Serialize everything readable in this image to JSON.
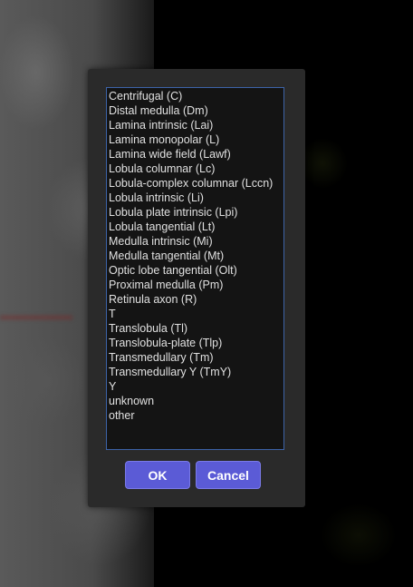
{
  "dialog": {
    "options": [
      "Centrifugal (C)",
      "Distal medulla (Dm)",
      "Lamina intrinsic (Lai)",
      "Lamina monopolar (L)",
      "Lamina wide field (Lawf)",
      "Lobula columnar (Lc)",
      "Lobula-complex columnar (Lccn)",
      "Lobula intrinsic (Li)",
      "Lobula plate intrinsic (Lpi)",
      "Lobula tangential (Lt)",
      "Medulla intrinsic (Mi)",
      "Medulla tangential (Mt)",
      "Optic lobe tangential (Olt)",
      "Proximal medulla (Pm)",
      "Retinula axon (R)",
      "T",
      "Translobula (Tl)",
      "Translobula-plate (Tlp)",
      "Transmedullary (Tm)",
      "Transmedullary Y (TmY)",
      "Y",
      "unknown",
      "other"
    ],
    "ok_label": "OK",
    "cancel_label": "Cancel"
  },
  "colors": {
    "button_bg": "#5b5bd6",
    "dialog_bg": "#2a2a2a",
    "listbox_bg": "#141414",
    "listbox_border": "#3d63a8"
  }
}
